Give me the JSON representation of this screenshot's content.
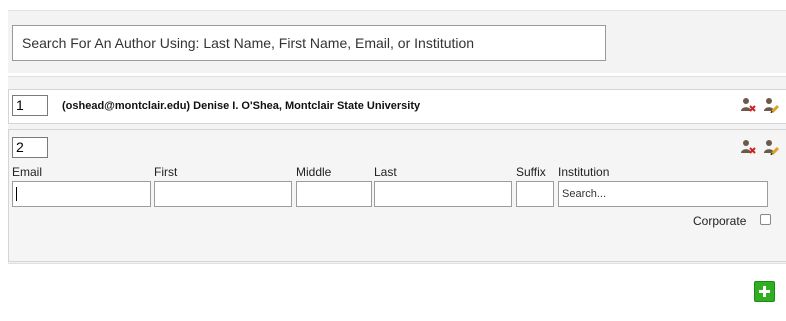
{
  "search": {
    "placeholder": "Search For An Author Using: Last Name, First Name, Email, or Institution"
  },
  "authors": [
    {
      "order": "1",
      "summary": "(oshead@montclair.edu) Denise I. O'Shea, Montclair State University"
    },
    {
      "order": "2",
      "labels": {
        "email": "Email",
        "first": "First",
        "middle": "Middle",
        "last": "Last",
        "suffix": "Suffix",
        "institution": "Institution"
      },
      "values": {
        "email": "",
        "first": "",
        "middle": "",
        "last": "",
        "suffix": ""
      },
      "institution_placeholder": "Search...",
      "corporate_label": "Corporate",
      "corporate_checked": false
    }
  ],
  "icons": {
    "remove": "remove-author-icon",
    "edit": "edit-author-icon",
    "add": "add-author-icon"
  },
  "colors": {
    "add_button": "#2fae22",
    "remove_badge": "#d42020",
    "edit_pencil": "#e0a020"
  }
}
